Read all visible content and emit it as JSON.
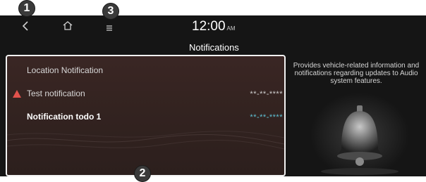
{
  "callouts": {
    "one": "1",
    "two": "2",
    "three": "3"
  },
  "status": {
    "time": "12:00",
    "ampm": "AM"
  },
  "page": {
    "title": "Notifications"
  },
  "notifications": [
    {
      "label": "Location Notification",
      "date": ""
    },
    {
      "label": "Test notification",
      "date": "**-**-****"
    },
    {
      "label": "Notification todo 1",
      "date": "**-**-****"
    }
  ],
  "description": "Provides vehicle-related information and notifications regarding updates to Audio system features.",
  "icons": {
    "back": "back-icon",
    "home": "home-icon",
    "menu": "menu-icon",
    "warning": "warning-triangle-icon",
    "bell": "bell-icon"
  },
  "colors": {
    "warning": "#e2524c",
    "date_highlight": "#5fc2d6",
    "panel_border": "#f2f2f2"
  }
}
